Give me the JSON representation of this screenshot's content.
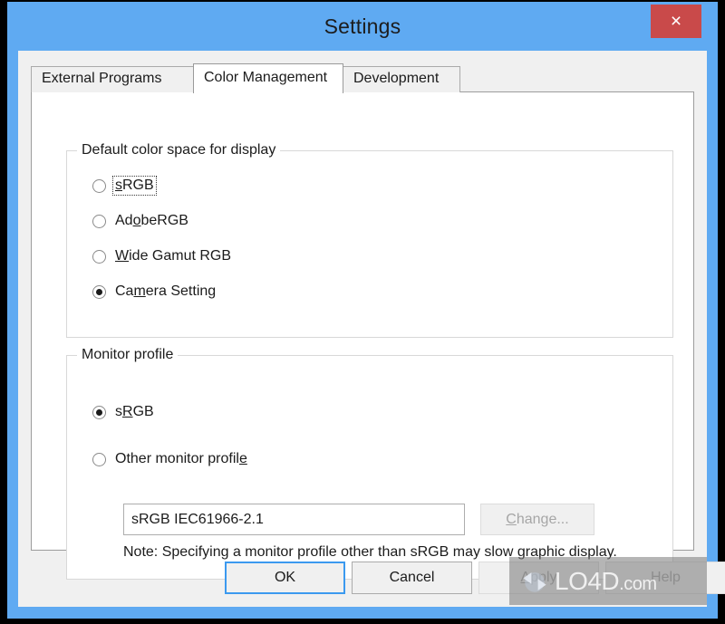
{
  "window": {
    "title": "Settings",
    "close_label": "×",
    "frame_color": "#5faaf2",
    "close_color": "#c94a4a"
  },
  "tabs": [
    {
      "label": "External Programs",
      "active": false
    },
    {
      "label": "Color Management",
      "active": true
    },
    {
      "label": "Development",
      "active": false
    }
  ],
  "color_space_group": {
    "title": "Default color space for display",
    "options": [
      {
        "pre": "",
        "acc": "s",
        "post": "RGB",
        "checked": false,
        "focused": true
      },
      {
        "pre": "Ad",
        "acc": "o",
        "post": "beRGB",
        "checked": false,
        "focused": false
      },
      {
        "pre": "",
        "acc": "W",
        "post": "ide Gamut RGB",
        "checked": false,
        "focused": false
      },
      {
        "pre": "Ca",
        "acc": "m",
        "post": "era Setting",
        "checked": true,
        "focused": false
      }
    ]
  },
  "monitor_group": {
    "title": "Monitor profile",
    "options": [
      {
        "pre": "s",
        "acc": "R",
        "post": "GB",
        "checked": true,
        "focused": false
      },
      {
        "pre": "Other monitor profil",
        "acc": "e",
        "post": "",
        "checked": false,
        "focused": false
      }
    ],
    "profile_value": "sRGB IEC61966-2.1",
    "profile_placeholder": "",
    "change_button": {
      "pre": "",
      "acc": "C",
      "post": "hange...",
      "disabled": true
    },
    "note": "Note: Specifying a monitor profile other than sRGB may slow graphic display."
  },
  "buttons": [
    {
      "id": "ok",
      "pre": "OK",
      "acc": "",
      "post": "",
      "default": true,
      "disabled": false
    },
    {
      "id": "cancel",
      "pre": "Cancel",
      "acc": "",
      "post": "",
      "default": false,
      "disabled": false
    },
    {
      "id": "apply",
      "pre": "",
      "acc": "A",
      "post": "pply",
      "default": false,
      "disabled": true
    },
    {
      "id": "help",
      "pre": "Help",
      "acc": "",
      "post": "",
      "default": false,
      "disabled": true
    }
  ],
  "watermark": {
    "name": "LO4D",
    "tld": ".com"
  }
}
